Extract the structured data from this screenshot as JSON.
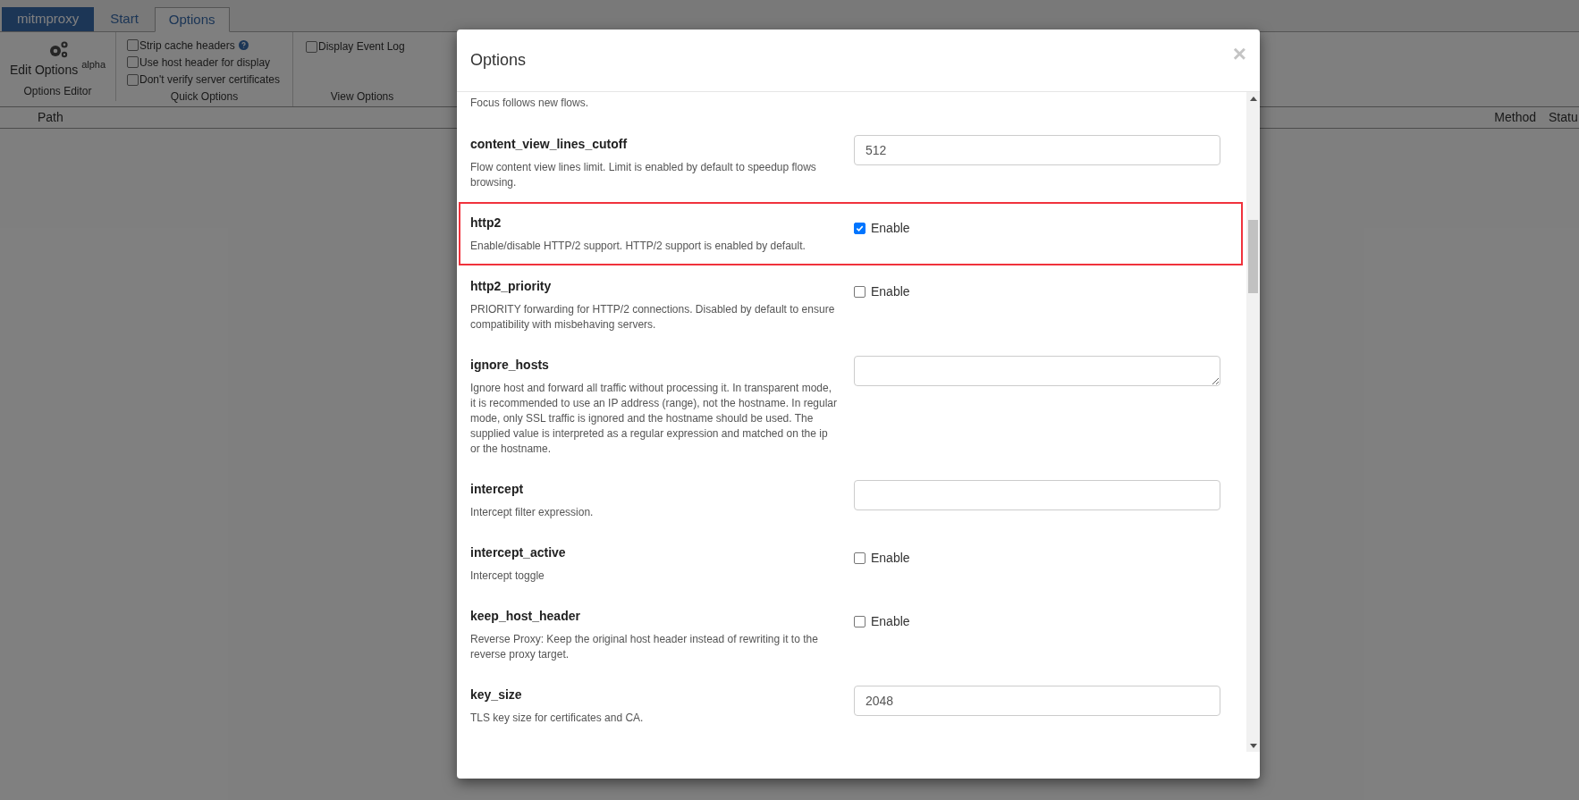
{
  "app": {
    "brand": "mitmproxy",
    "tabs": [
      {
        "label": "Start",
        "selected": false
      },
      {
        "label": "Options",
        "selected": true
      }
    ],
    "toolbar": {
      "edit_options": {
        "label": "Edit Options",
        "badge": "alpha",
        "group": "Options Editor"
      },
      "quick_options": {
        "group": "Quick Options",
        "items": [
          {
            "label": "Strip cache headers",
            "checked": false,
            "help": true
          },
          {
            "label": "Use host header for display",
            "checked": false,
            "help": false
          },
          {
            "label": "Don't verify server certificates",
            "checked": false,
            "help": false
          }
        ]
      },
      "view_options": {
        "group": "View Options",
        "items": [
          {
            "label": "Display Event Log",
            "checked": false
          }
        ]
      }
    },
    "table": {
      "columns": [
        "Path",
        "Method",
        "Statu"
      ]
    }
  },
  "dialog": {
    "title": "Options",
    "close": "×",
    "options": [
      {
        "kind": "none",
        "description": "Focus follows new flows.",
        "highlighted": false
      },
      {
        "kind": "text",
        "name": "content_view_lines_cutoff",
        "description": "Flow content view lines limit. Limit is enabled by default to speedup flows browsing.",
        "value": "512",
        "highlighted": false
      },
      {
        "kind": "checkbox",
        "name": "http2",
        "description": "Enable/disable HTTP/2 support. HTTP/2 support is enabled by default.",
        "label": "Enable",
        "checked": true,
        "highlighted": true
      },
      {
        "kind": "checkbox",
        "name": "http2_priority",
        "description": "PRIORITY forwarding for HTTP/2 connections. Disabled by default to ensure compatibility with misbehaving servers.",
        "label": "Enable",
        "checked": false,
        "highlighted": false
      },
      {
        "kind": "textarea",
        "name": "ignore_hosts",
        "description": "Ignore host and forward all traffic without processing it. In transparent mode, it is recommended to use an IP address (range), not the hostname. In regular mode, only SSL traffic is ignored and the hostname should be used. The supplied value is interpreted as a regular expression and matched on the ip or the hostname.",
        "highlighted": false
      },
      {
        "kind": "text",
        "name": "intercept",
        "description": "Intercept filter expression.",
        "highlighted": false
      },
      {
        "kind": "checkbox",
        "name": "intercept_active",
        "description": "Intercept toggle",
        "label": "Enable",
        "checked": false,
        "highlighted": false
      },
      {
        "kind": "checkbox",
        "name": "keep_host_header",
        "description": "Reverse Proxy: Keep the original host header instead of rewriting it to the reverse proxy target.",
        "label": "Enable",
        "checked": false,
        "highlighted": false
      },
      {
        "kind": "text",
        "name": "key_size",
        "description": "TLS key size for certificates and CA.",
        "value": "2048",
        "highlighted": false
      }
    ]
  }
}
